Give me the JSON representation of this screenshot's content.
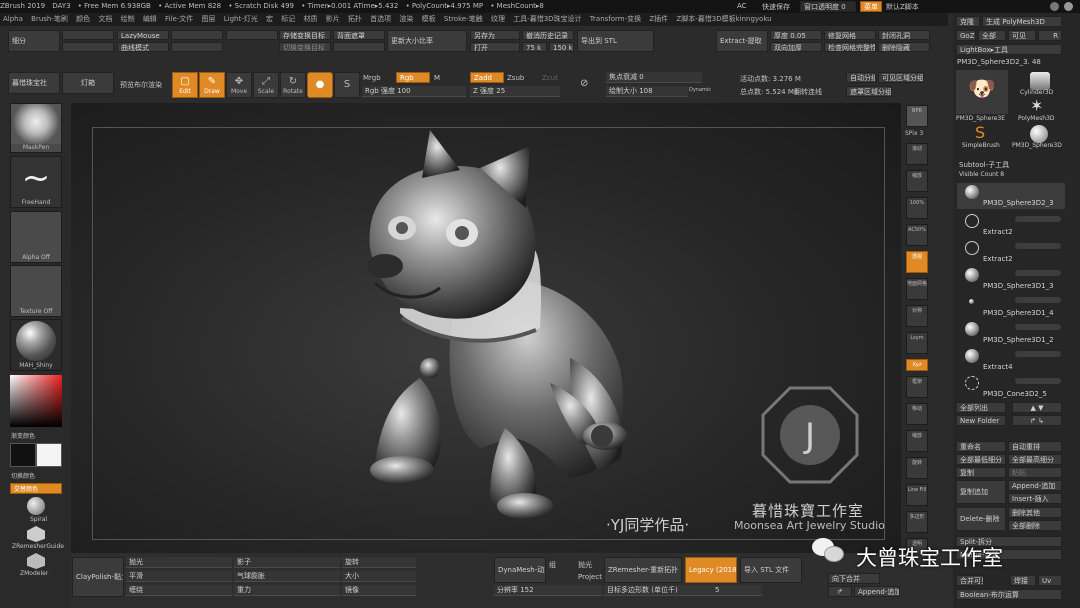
{
  "title_bar": {
    "app": "ZBrush 2019",
    "doc": "DAY3",
    "stats": [
      "• Free Mem 6.938GB",
      "• Active Mem 828",
      "• Scratch Disk 499",
      "• Timer▸0.001 ATime▸5.432",
      "• PolyCount▸4.975 MP",
      "• MeshCount▸8"
    ],
    "menu_title": "工具-暮惜珠宝3D珠宝设计",
    "menu_transform": "Transform-变换",
    "menu_zplugin": "Z插件",
    "menu_zscript": "Z脚本-暮惜3D模板kinngyoku",
    "ac": "AC",
    "quicksave": "快速保存",
    "transparency": "窗口透明度 0",
    "menu_btn": "菜单",
    "default_script": "默认Z脚本"
  },
  "menu": [
    "Alpha",
    "Brush-笔刷",
    "颜色",
    "文档",
    "绘制",
    "编辑",
    "File-文件",
    "图层",
    "Light-灯光",
    "宏",
    "标记",
    "材质",
    "影片",
    "拓扑",
    "首选项",
    "渲染",
    "模板",
    "Stroke-笔触",
    "纹理",
    "工具-暮惜3D珠宝设计",
    "Transform-变换",
    "Z插件",
    "Z脚本-暮惜3D模板kinngyoku"
  ],
  "top": {
    "fine_split": "细分",
    "lazy_mouse": "LazyMouse",
    "curve_mode": "曲线模式",
    "save_target": "存储变换目标",
    "switch_target": "切换变换目标",
    "bg_mask": "背面遮罩",
    "refresh_ratio": "更新大小比率",
    "save_as": "另存为",
    "open": "打开",
    "undo_history": "撤消历史记录",
    "undo_val": "75 k",
    "redo_val": "150 k",
    "export_stl": "导出到 STL",
    "extract": "Extract-提取",
    "thickness": "厚度 0.05",
    "repair_mesh": "修复网格",
    "double_sided": "双向加厚",
    "check_mesh": "检查网格完整性",
    "close_hole": "封闭孔洞",
    "delete_hidden": "删除隐藏",
    "jewelry_society": "暮惜珠宝社",
    "lights": "灯箱",
    "preview_render": "预览布尔渲染",
    "edit_btn": "Edit",
    "draw_btn": "Draw",
    "move_btn": "Move",
    "scale_btn": "Scale",
    "rotate_btn": "Rotate",
    "mrgb": "Mrgb",
    "rgb": "Rgb",
    "m": "M",
    "zadd": "Zadd",
    "zsub": "Zsub",
    "zcut": "Zcut",
    "rgb_intensity": "Rgb 强度 100",
    "z_intensity": "Z 强度 25",
    "focal_shift": "焦点衰减 0",
    "draw_size": "绘制大小 108",
    "dynamic": "Dynamic",
    "active_points": "活动点数: 3.276 M",
    "total_points": "总点数: 5.524 Mil",
    "show_edges": "重量显示",
    "edge_loop": "翻转连线",
    "auto_group": "自动分组",
    "visible_group": "可见区域分组",
    "mask_group": "遮罩区域分组"
  },
  "left": {
    "mask_pen": "MaskPen",
    "freehand": "FreeHand",
    "alpha_off": "Alpha Off",
    "texture_off": "Texture Off",
    "material": "MAH_Shiny",
    "gradient": "渐变颜色",
    "switch_color": "切换颜色",
    "alternate": "交替颜色",
    "spiral": "Spiral",
    "zremesher_guide": "ZRemesherGuide",
    "zmodeler": "ZModeler"
  },
  "right_tools": [
    "BPR",
    "SPix 3",
    "滚动",
    "缩放",
    "100%",
    "AC50%",
    "透视",
    "地面网格",
    "对称",
    "Lsym",
    "Xyz",
    "框架",
    "移动",
    "缩放",
    "旋转",
    "Line Fill",
    "多边形",
    "透明",
    "隔离"
  ],
  "canvas": {
    "watermark_cn": "暮惜珠寶工作室",
    "watermark_en": "Moonsea Art Jewelry Studio",
    "author": "·YJ同学作品·",
    "logo_letter": "J"
  },
  "panel": {
    "clone": "克隆",
    "gen_polymesh": "生成 PolyMesh3D",
    "goz": "GoZ",
    "all": "全部",
    "visible": "可见",
    "r": "R",
    "lightbox_tools": "LightBox▸工具",
    "current_tool": "PM3D_Sphere3D2_3. 48",
    "thumbs": [
      "PM3D_Sphere3E",
      "Cylinder3D",
      "PolyMesh3D",
      "SimpleBrush",
      "PM3D_Sphere3D"
    ],
    "subtool": "Subtool-子工具",
    "visible_count": "Visible Count 8",
    "subtools": [
      "PM3D_Sphere3D2_3",
      "Extract2",
      "Extract2",
      "PM3D_Sphere3D1_3",
      "PM3D_Sphere3D1_4",
      "PM3D_Sphere3D1_2",
      "Extract4",
      "PM3D_Cone3D2_5"
    ],
    "all_list": "全部列出",
    "new_folder": "New Folder",
    "rename": "重命名",
    "auto_reorder": "自动重排",
    "all_low": "全部最低细分",
    "all_high": "全部最高细分",
    "copy": "复制",
    "paste": "粘贴",
    "copy_append": "复制追加",
    "append": "Append-追加",
    "insert": "Insert-插入",
    "delete": "Delete-删除",
    "delete_other": "删除其他",
    "delete_all": "全部删除",
    "split": "Split-拆分",
    "merge": "Merge-合并",
    "merge_down": "向下合并",
    "merge_visible": "合并可见",
    "weld": "焊接",
    "uv": "Uv",
    "boolean": "Boolean-布尔运算"
  },
  "bottom": {
    "brush_name": "ClayPolish-黏土抛光",
    "polish": "抛光",
    "flatten": "平滑",
    "wrap": "缠绕",
    "shadow": "影子",
    "gas_bubble": "气球膨胀",
    "gravity": "重力",
    "rotate": "旋转",
    "size": "大小",
    "mirror": "镜像",
    "dynamesh": "DynaMesh-动态网格",
    "resolution": "分辨率 152",
    "group": "组",
    "project": "Project",
    "polish2": "抛光",
    "zremesher": "ZRemesher-重新拓扑",
    "legacy": "Legacy (2018)",
    "import_stl": "导入 STL 文件",
    "target_poly": "目标多边形数 (单位千)",
    "target_val": "5",
    "copy_append": "复制追加",
    "merge_down": "向下合并",
    "append": "Append-追加"
  },
  "wechat": {
    "name": "大曾珠宝工作室"
  }
}
